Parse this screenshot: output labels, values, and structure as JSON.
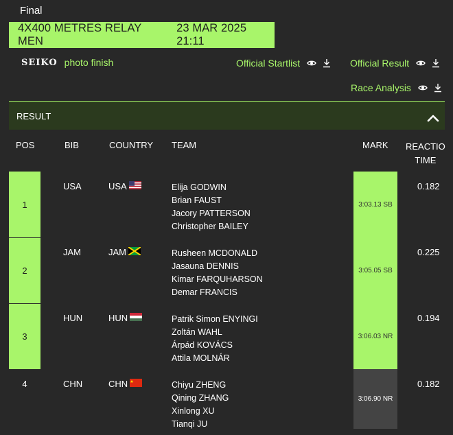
{
  "phase": "Final",
  "event": {
    "name": "4X400 METRES RELAY MEN",
    "datetime": "23 MAR 2025 21:11"
  },
  "brand": {
    "logo": "SEIKO",
    "photo_finish": "photo finish"
  },
  "documents": [
    {
      "label": "Official Startlist"
    },
    {
      "label": "Official Result"
    },
    {
      "label": "Race Analysis"
    }
  ],
  "result": {
    "section_label": "RESULT",
    "columns": {
      "pos": "POS",
      "bib": "BIB",
      "country": "COUNTRY",
      "team": "TEAM",
      "mark": "MARK",
      "reaction_l1": "REACTIO",
      "reaction_l2": "TIME"
    },
    "rows": [
      {
        "pos": "1",
        "bib": "USA",
        "country": "USA",
        "flag": "usa-flag-icon",
        "team": [
          "Elija GODWIN",
          "Brian FAUST",
          "Jacory PATTERSON",
          "Christopher BAILEY"
        ],
        "mark": "3:03.13 SB",
        "reaction": "0.182"
      },
      {
        "pos": "2",
        "bib": "JAM",
        "country": "JAM",
        "flag": "jamaica-flag-icon",
        "team": [
          "Rusheen MCDONALD",
          "Jasauna DENNIS",
          "Kimar FARQUHARSON",
          "Demar FRANCIS"
        ],
        "mark": "3:05.05 SB",
        "reaction": "0.225"
      },
      {
        "pos": "3",
        "bib": "HUN",
        "country": "HUN",
        "flag": "hungary-flag-icon",
        "team": [
          "Patrik Simon ENYINGI",
          "Zoltán WAHL",
          "Árpád KOVÁCS",
          "Attila MOLNÁR"
        ],
        "mark": "3:06.03 NR",
        "reaction": "0.194"
      },
      {
        "pos": "4",
        "bib": "CHN",
        "country": "CHN",
        "flag": "china-flag-icon",
        "team": [
          "Chiyu ZHENG",
          "Qining ZHANG",
          "Xinlong XU",
          "Tianqi JU"
        ],
        "mark": "3:06.90 NR",
        "reaction": "0.182"
      }
    ]
  },
  "colors": {
    "accent": "#a8f56a",
    "background": "#282828",
    "header_bg": "#2b3a1e"
  }
}
